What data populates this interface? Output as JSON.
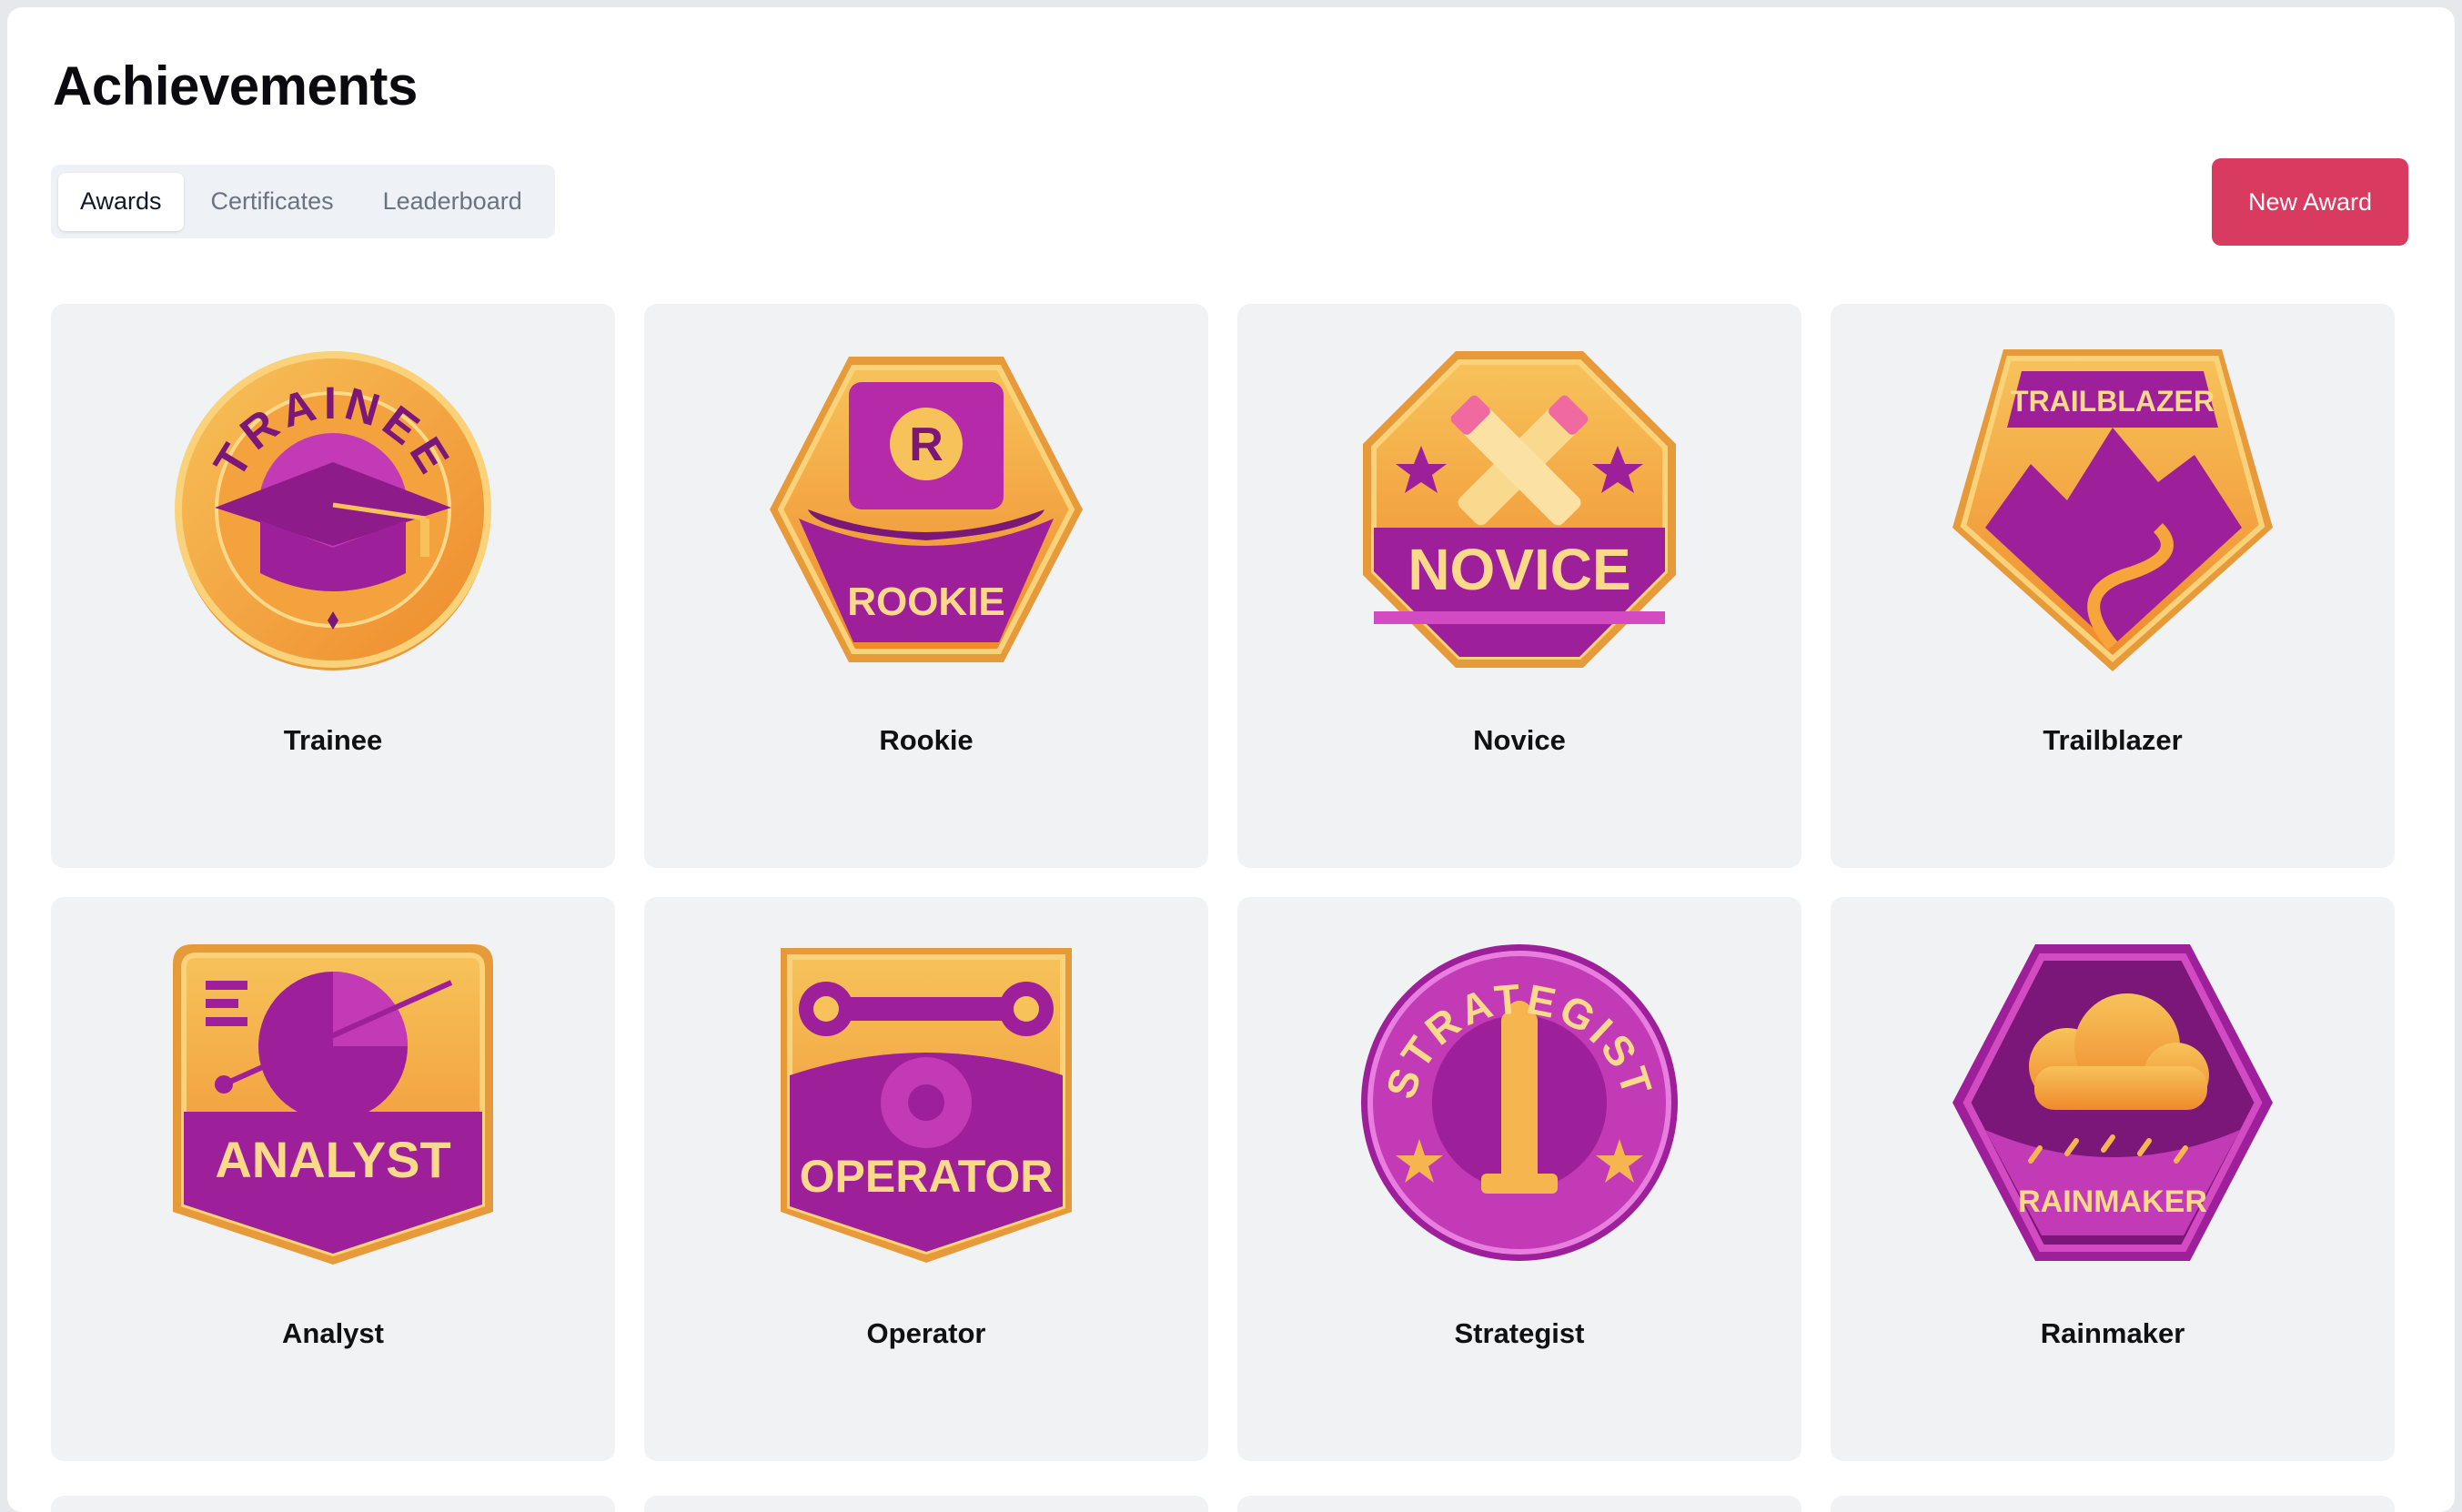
{
  "page": {
    "title": "Achievements"
  },
  "tabs": [
    {
      "label": "Awards",
      "active": true
    },
    {
      "label": "Certificates",
      "active": false
    },
    {
      "label": "Leaderboard",
      "active": false
    }
  ],
  "actions": {
    "new_award_label": "New Award"
  },
  "colors": {
    "accent": "#d93a5f",
    "badge_gold": "#f5b043",
    "badge_orange": "#f08a2b",
    "badge_magenta": "#b0209e",
    "badge_purple": "#7a1778",
    "card_bg": "#f1f2f4"
  },
  "awards": [
    {
      "name": "Trainee",
      "badge_text": "TRAINEE",
      "icon": "graduation-cap-icon"
    },
    {
      "name": "Rookie",
      "badge_text": "ROOKIE",
      "icon": "cap-icon"
    },
    {
      "name": "Novice",
      "badge_text": "NOVICE",
      "icon": "crossed-pencils-icon"
    },
    {
      "name": "Trailblazer",
      "badge_text": "TRAILBLAZER",
      "icon": "mountain-icon"
    },
    {
      "name": "Analyst",
      "badge_text": "ANALYST",
      "icon": "pie-chart-icon"
    },
    {
      "name": "Operator",
      "badge_text": "OPERATOR",
      "icon": "wrench-gear-icon"
    },
    {
      "name": "Strategist",
      "badge_text": "STRATEGIST",
      "icon": "chess-piece-icon"
    },
    {
      "name": "Rainmaker",
      "badge_text": "RAINMAKER",
      "icon": "rain-cloud-icon"
    }
  ]
}
